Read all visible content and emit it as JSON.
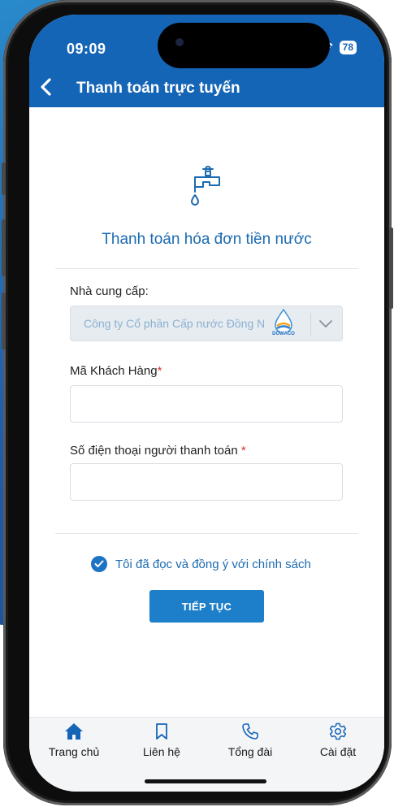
{
  "status_bar": {
    "time": "09:09",
    "battery": "78"
  },
  "header": {
    "title": "Thanh toán trực tuyến",
    "back_icon": "chevron-left-icon"
  },
  "service": {
    "title": "Thanh toán hóa đơn tiền nước",
    "icon": "water-tap-icon"
  },
  "form": {
    "provider": {
      "label": "Nhà cung cấp:",
      "value": "Công ty Cổ phần Cấp nước Đồng Nai",
      "logo_text": "DOWACO"
    },
    "customer_code": {
      "label": "Mã Khách Hàng",
      "required_mark": "*",
      "value": ""
    },
    "payer_phone": {
      "label": "Số điện thoại người thanh toán ",
      "required_mark": "*",
      "value": ""
    },
    "agree": {
      "label": "Tôi đã đọc và đồng ý với chính sách",
      "checked": true
    },
    "continue_label": "TIẾP TỤC"
  },
  "tabbar": [
    {
      "label": "Trang chủ",
      "icon": "home-icon",
      "active": true
    },
    {
      "label": "Liên hệ",
      "icon": "bookmark-icon",
      "active": false
    },
    {
      "label": "Tổng đài",
      "icon": "phone-icon",
      "active": false
    },
    {
      "label": "Cài đặt",
      "icon": "gear-icon",
      "active": false
    }
  ],
  "colors": {
    "header": "#1565b7",
    "accent": "#1d7fc9",
    "link": "#1b6bb0"
  }
}
